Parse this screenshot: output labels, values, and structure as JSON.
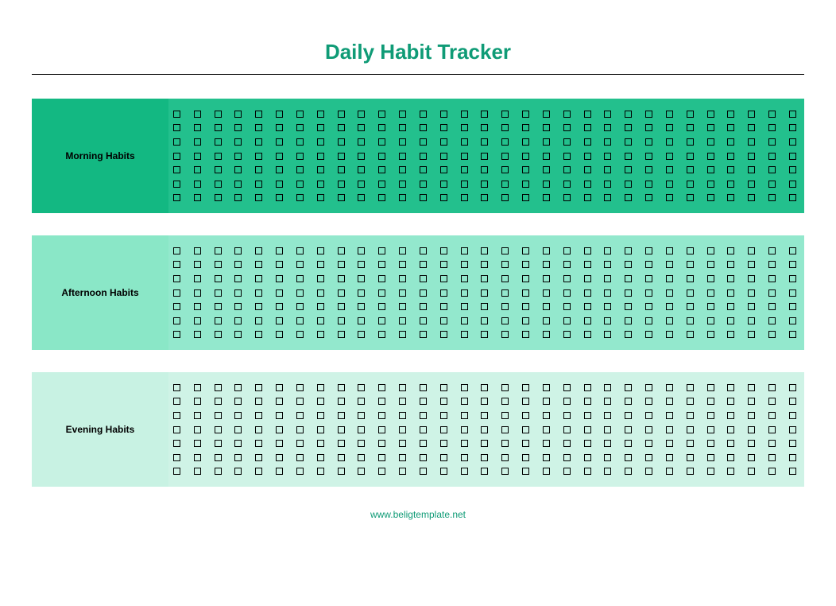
{
  "title": "Daily Habit Tracker",
  "footer": "www.beligtemplate.net",
  "rows_per_section": 7,
  "cols_per_row": 31,
  "sections": [
    {
      "label": "Morning Habits",
      "label_bg": "#13b882",
      "grid_bg": "#23c08d"
    },
    {
      "label": "Afternoon Habits",
      "label_bg": "#8ae7c7",
      "grid_bg": "#93e8cd"
    },
    {
      "label": "Evening Habits",
      "label_bg": "#c8f2e3",
      "grid_bg": "#cff3e6"
    }
  ]
}
